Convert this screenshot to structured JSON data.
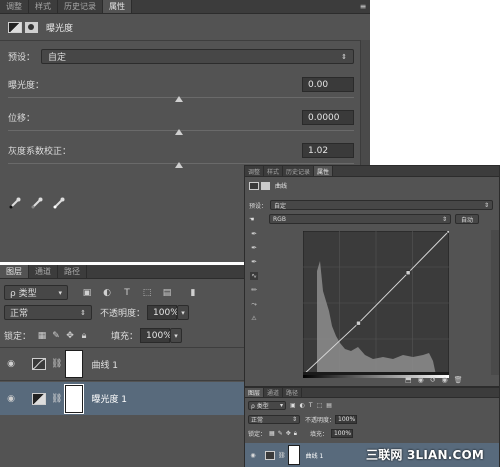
{
  "panel1": {
    "tabs": [
      "调整",
      "样式",
      "历史记录",
      "属性"
    ],
    "active_tab_index": 3,
    "header_title": "曝光度",
    "preset_label": "预设：",
    "preset_value": "自定",
    "sliders": [
      {
        "label": "曝光度：",
        "value": "0.00",
        "position": 0.5
      },
      {
        "label": "位移：",
        "value": "0.0000",
        "position": 0.5
      },
      {
        "label": "灰度系数校正：",
        "value": "1.02",
        "position": 0.5
      }
    ],
    "eyedroppers": [
      "black-point-eyedropper-icon",
      "gray-point-eyedropper-icon",
      "white-point-eyedropper-icon"
    ]
  },
  "layers1": {
    "tabs": [
      "图层",
      "通道",
      "路径"
    ],
    "filter_label": "ρ 类型",
    "blend_mode": "正常",
    "opacity_label": "不透明度：",
    "opacity_value": "100%",
    "lock_label": "锁定：",
    "fill_label": "填充：",
    "fill_value": "100%",
    "layers": [
      {
        "name": "曲线 1",
        "selected": false,
        "icon": "curves-adjustment-icon"
      },
      {
        "name": "曝光度 1",
        "selected": true,
        "icon": "exposure-adjustment-icon"
      }
    ]
  },
  "panel2": {
    "tabs": [
      "调整",
      "样式",
      "历史记录",
      "属性"
    ],
    "active_tab_index": 3,
    "header_title": "曲线",
    "preset_label": "预设：",
    "preset_value": "自定",
    "channel_value": "RGB",
    "auto_label": "自动",
    "curve_points": [
      [
        0,
        0
      ],
      [
        0.38,
        0.36
      ],
      [
        0.72,
        0.71
      ],
      [
        1,
        1
      ]
    ]
  },
  "layers2": {
    "tabs": [
      "图层",
      "通道",
      "路径"
    ],
    "filter_label": "ρ 类型",
    "blend_mode": "正常",
    "opacity_label": "不透明度：",
    "opacity_value": "100%",
    "lock_label": "锁定：",
    "fill_label": "填充：",
    "fill_value": "100%",
    "layer_name": "曲线 1"
  },
  "watermark": "三联网 3LIAN.COM",
  "colors": {
    "panel": "#535353",
    "tabbar": "#3c3c3c",
    "selected_layer": "#586a7c"
  }
}
